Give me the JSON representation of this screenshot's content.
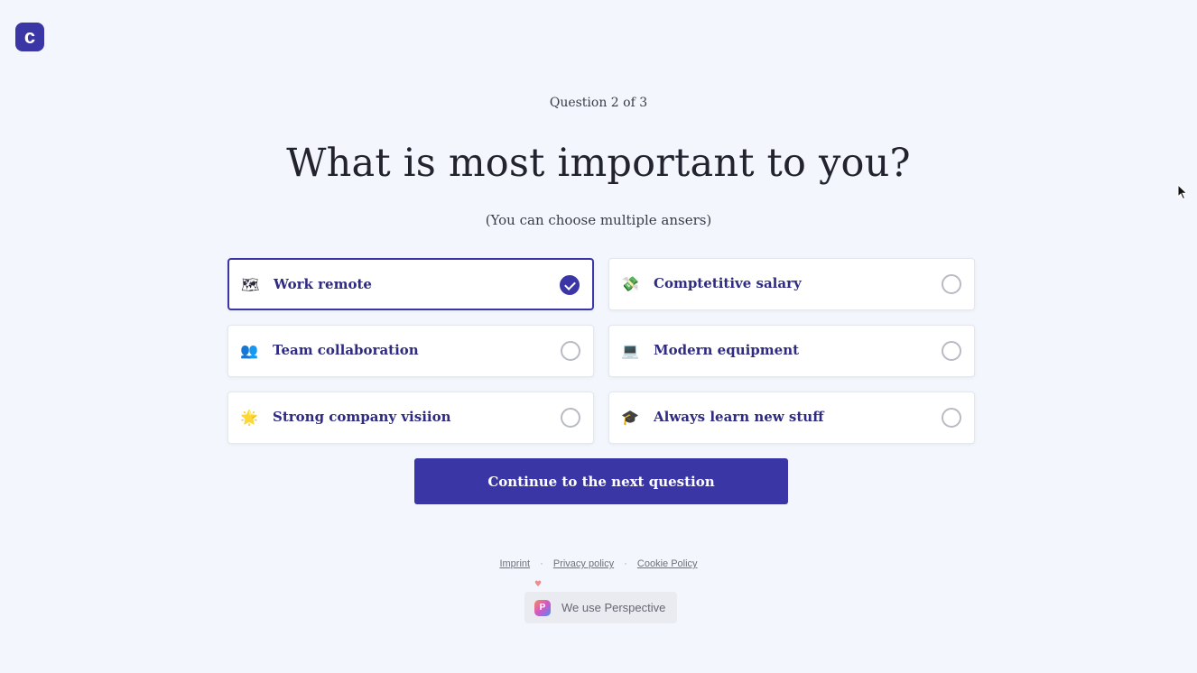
{
  "brand": {
    "logo_letter": "c",
    "accent": "#3a36a6"
  },
  "quiz": {
    "step": "Question 2 of 3",
    "title": "What is most important to you?",
    "hint": "(You can choose multiple ansers)",
    "options": [
      {
        "label": "Work remote",
        "icon": "map-icon",
        "glyph": "🗺",
        "selected": true
      },
      {
        "label": "Comptetitive salary",
        "icon": "money-wings-icon",
        "glyph": "💸",
        "selected": false
      },
      {
        "label": "Team collaboration",
        "icon": "people-icon",
        "glyph": "👥",
        "selected": false
      },
      {
        "label": "Modern equipment",
        "icon": "laptop-icon",
        "glyph": "💻",
        "selected": false
      },
      {
        "label": "Strong company visiion",
        "icon": "sparkle-star-icon",
        "glyph": "🌟",
        "selected": false
      },
      {
        "label": "Always learn new stuff",
        "icon": "graduation-cap-icon",
        "glyph": "🎓",
        "selected": false
      }
    ],
    "continue_label": "Continue to the next question"
  },
  "footer": {
    "imprint": "Imprint",
    "privacy": "Privacy policy",
    "cookie": "Cookie Policy",
    "separator": "·"
  },
  "badge": {
    "logo_letter": "P",
    "text": "We use Perspective"
  }
}
